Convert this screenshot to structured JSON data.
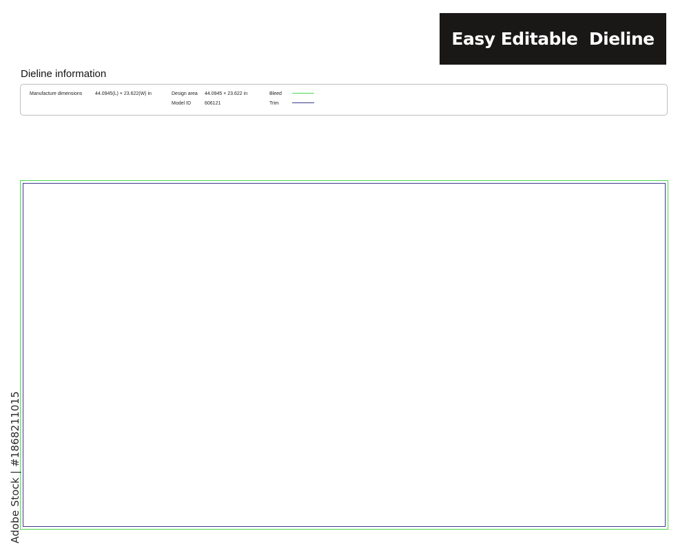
{
  "badge": {
    "text": "Easy Editable  Dieline"
  },
  "dieline_info": {
    "title": "Dieline information",
    "manufacture_dimensions_label": "Manufacture dimensions",
    "manufacture_dimensions_value": "44.0945(L) × 23.622(W) in",
    "design_area_label": "Design area",
    "design_area_value": "44.0945 × 23.622 in",
    "model_id_label": "Model ID",
    "model_id_value": "606121",
    "bleed_label": "Bleed",
    "trim_label": "Trim"
  },
  "colors": {
    "bleed": "#4cd64c",
    "trim": "#3a3a8c",
    "badge_background": "#1a1717"
  },
  "watermark": {
    "side_text": "Adobe Stock | #1868211015"
  }
}
